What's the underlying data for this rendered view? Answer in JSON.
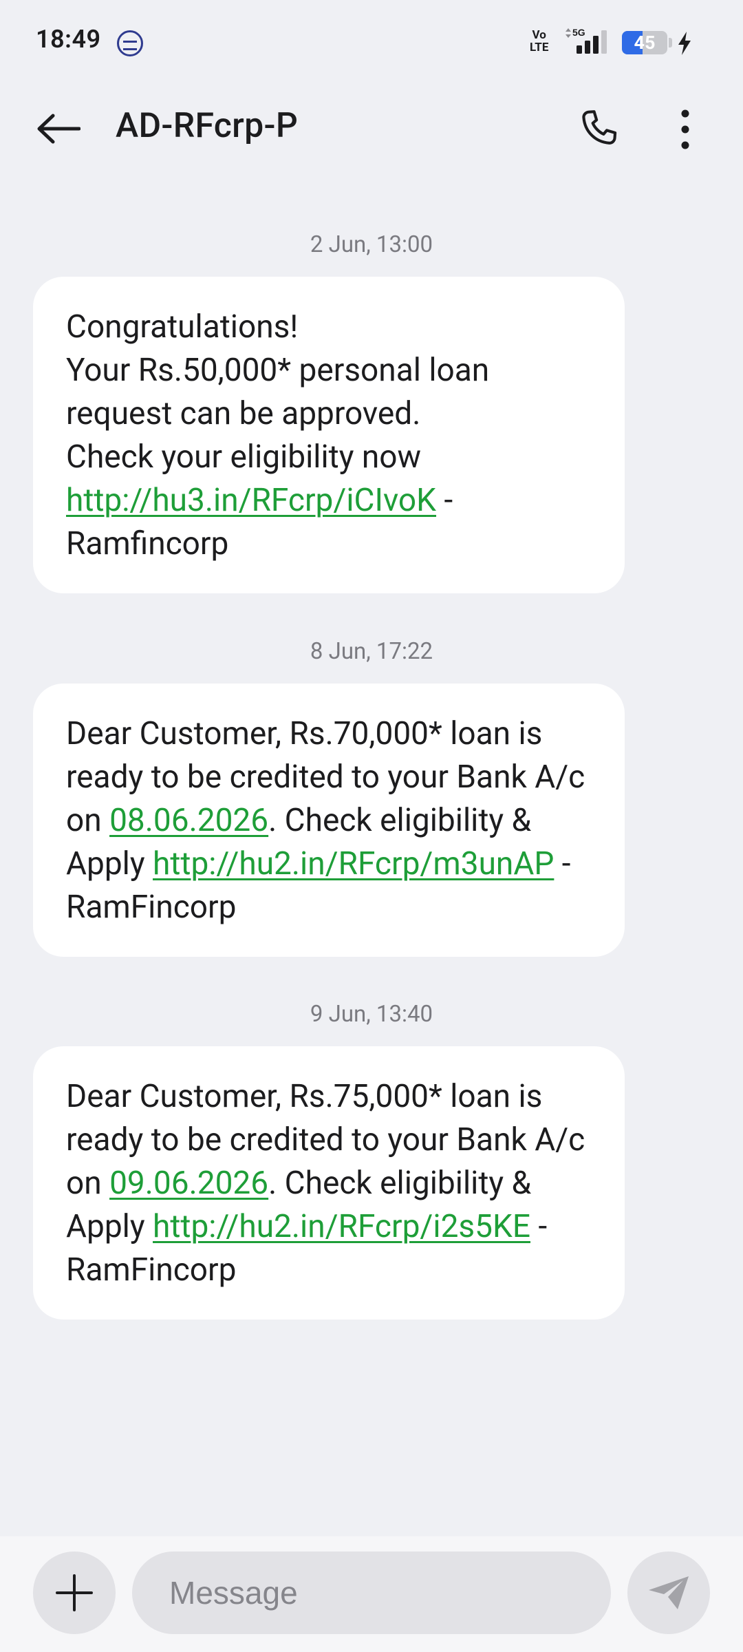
{
  "status_bar": {
    "time": "18:49",
    "app_icon": "ring-app-icon",
    "network_top": "Vo",
    "network_bottom": "LTE",
    "network_type": "5G",
    "battery_level": "45",
    "battery_fraction": 0.45,
    "charging": true
  },
  "app_bar": {
    "title": "AD-RFcrp-P",
    "back_icon": "arrow-left-icon",
    "call_icon": "phone-icon",
    "more_icon": "more-vertical-icon"
  },
  "messages": [
    {
      "timestamp": "2 Jun, 13:00",
      "lines": [
        "Congratulations!",
        "Your Rs.50,000* personal loan request can be approved.",
        "Check your eligibility now"
      ],
      "link": "http://hu3.in/RFcrp/iCIvoK",
      "suffix": " -",
      "signature": "Ramfincorp"
    },
    {
      "timestamp": "8 Jun, 17:22",
      "text_before_date": "Dear Customer, Rs.70,000* loan is ready to be credited to your Bank A/c on ",
      "date": "08.06.2026",
      "text_after_date": ". Check eligibility & Apply ",
      "link": "http://hu2.in/RFcrp/m3unAP",
      "suffix": " - RamFincorp"
    },
    {
      "timestamp": "9 Jun, 13:40",
      "text_before_date": "Dear Customer, Rs.75,000* loan is ready to be credited to your Bank A/c on ",
      "date": "09.06.2026",
      "text_after_date": ". Check eligibility & Apply ",
      "link": "http://hu2.in/RFcrp/i2s5KE",
      "suffix": " - RamFincorp"
    }
  ],
  "composer": {
    "placeholder": "Message",
    "add_icon": "plus-icon",
    "send_icon": "send-icon"
  },
  "colors": {
    "background": "#eff0f4",
    "bubble": "#ffffff",
    "link": "#1e9e38",
    "timestamp": "#7a7a80",
    "battery": "#2f6be6"
  }
}
